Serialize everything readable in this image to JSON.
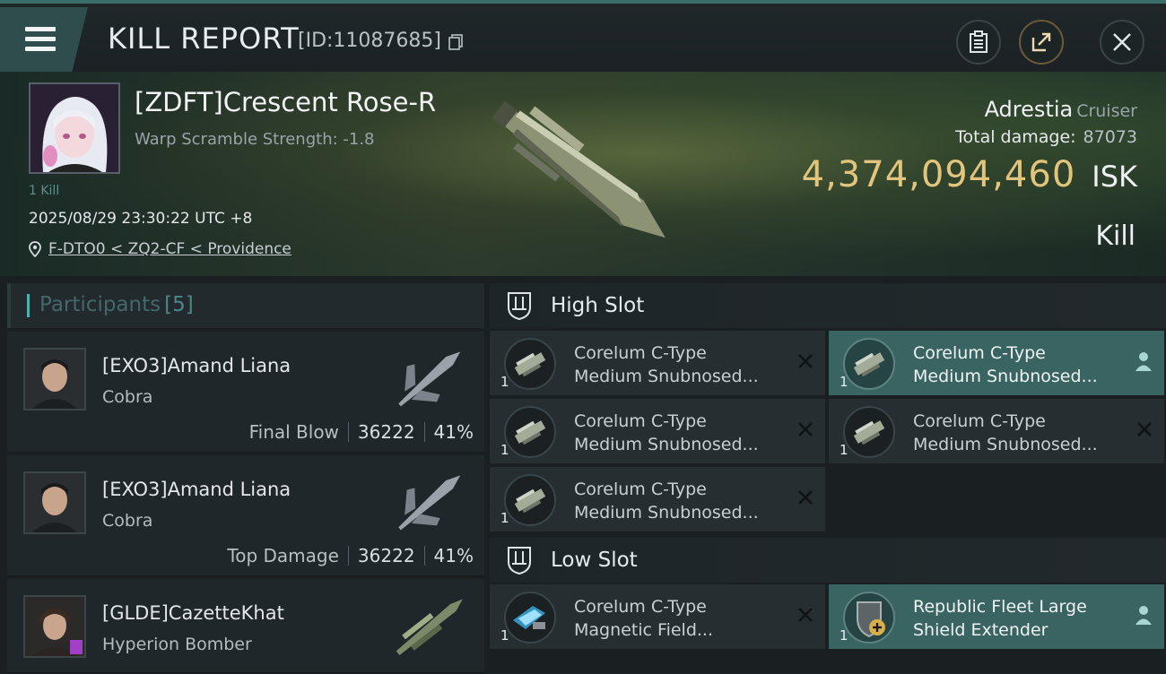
{
  "header": {
    "title": "KILL REPORT",
    "report_id": "[ID:11087685]"
  },
  "victim": {
    "name": "[ZDFT]Crescent Rose-R",
    "warp_scramble": "Warp Scramble Strength: -1.8",
    "kills_tag": "1 Kill",
    "timestamp": "2025/08/29 23:30:22 UTC +8",
    "location": "F-DTO0 < ZQ2-CF < Providence",
    "ship_name": "Adrestia",
    "ship_class": "Cruiser",
    "total_damage_label": "Total damage:",
    "total_damage": "87073",
    "isk_value": "4,374,094,460",
    "isk_unit": "ISK",
    "result": "Kill"
  },
  "participants": {
    "label": "Participants",
    "count": "[5]",
    "rows": [
      {
        "name": "[EXO3]Amand Liana",
        "ship": "Cobra",
        "role": "Final Blow",
        "damage": "36222",
        "percent": "41%"
      },
      {
        "name": "[EXO3]Amand Liana",
        "ship": "Cobra",
        "role": "Top Damage",
        "damage": "36222",
        "percent": "41%"
      },
      {
        "name": "[GLDE]CazetteKhat",
        "ship": "Hyperion Bomber",
        "role": "",
        "damage": "",
        "percent": ""
      }
    ]
  },
  "slots": {
    "high": {
      "title": "High Slot",
      "items": [
        {
          "line1": "Corelum C-Type",
          "line2": "Medium Snubnosed...",
          "qty": "1",
          "status": "destroyed"
        },
        {
          "line1": "Corelum C-Type",
          "line2": "Medium Snubnosed...",
          "qty": "1",
          "status": "dropped"
        },
        {
          "line1": "Corelum C-Type",
          "line2": "Medium Snubnosed...",
          "qty": "1",
          "status": "destroyed"
        },
        {
          "line1": "Corelum C-Type",
          "line2": "Medium Snubnosed...",
          "qty": "1",
          "status": "destroyed"
        },
        {
          "line1": "Corelum C-Type",
          "line2": "Medium Snubnosed...",
          "qty": "1",
          "status": "destroyed"
        }
      ]
    },
    "low": {
      "title": "Low Slot",
      "items": [
        {
          "line1": "Corelum C-Type",
          "line2": "Magnetic Field...",
          "qty": "1",
          "status": "destroyed"
        },
        {
          "line1": "Republic Fleet Large",
          "line2": "Shield Extender",
          "qty": "1",
          "status": "dropped"
        }
      ]
    }
  },
  "colors": {
    "accent": "#4fb0b0",
    "isk_gold": "#e2c57d",
    "dropped_item_bg": "#3a6461"
  }
}
